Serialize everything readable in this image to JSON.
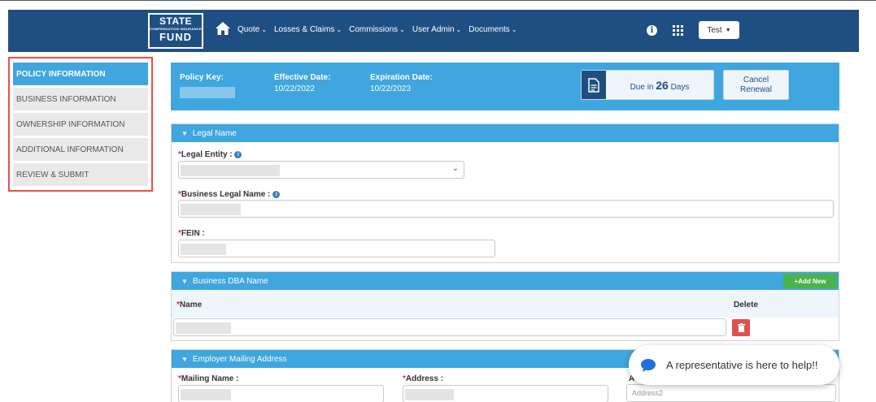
{
  "header": {
    "logo": {
      "line1": "STATE",
      "line2": "COMPENSATION INSURANCE",
      "line3": "FUND"
    },
    "menu": [
      {
        "label": "Quote"
      },
      {
        "label": "Losses & Claims"
      },
      {
        "label": "Commissions"
      },
      {
        "label": "User Admin"
      },
      {
        "label": "Documents"
      }
    ],
    "user_label": "Test",
    "colors": {
      "navbar": "#1f4f82",
      "accent": "#3fa6e0"
    }
  },
  "sidebar": {
    "items": [
      {
        "label": "POLICY INFORMATION",
        "active": true
      },
      {
        "label": "BUSINESS INFORMATION"
      },
      {
        "label": "OWNERSHIP INFORMATION"
      },
      {
        "label": "ADDITIONAL INFORMATION"
      },
      {
        "label": "REVIEW & SUBMIT"
      }
    ]
  },
  "policy": {
    "key_label": "Policy Key:",
    "effective_label": "Effective Date:",
    "effective_value": "10/22/2022",
    "expiration_label": "Expiration Date:",
    "expiration_value": "10/22/2023",
    "due_prefix": "Due in",
    "due_days": "26",
    "due_suffix": "Days",
    "cancel_line1": "Cancel",
    "cancel_line2": "Renewal"
  },
  "legal": {
    "title": "Legal Name",
    "entity_label": "Legal Entity :",
    "business_name_label": "Business Legal Name :",
    "fein_label": "FEIN :"
  },
  "dba": {
    "title": "Business DBA Name",
    "add_label": "+Add New",
    "name_col": "Name",
    "delete_col": "Delete"
  },
  "mailing": {
    "title": "Employer Mailing Address",
    "name_label": "Mailing Name :",
    "address_label": "Address :",
    "address2_label_partial": "A",
    "address2_placeholder": "Address2"
  },
  "chat": {
    "text": "A representative is here to help!!"
  }
}
